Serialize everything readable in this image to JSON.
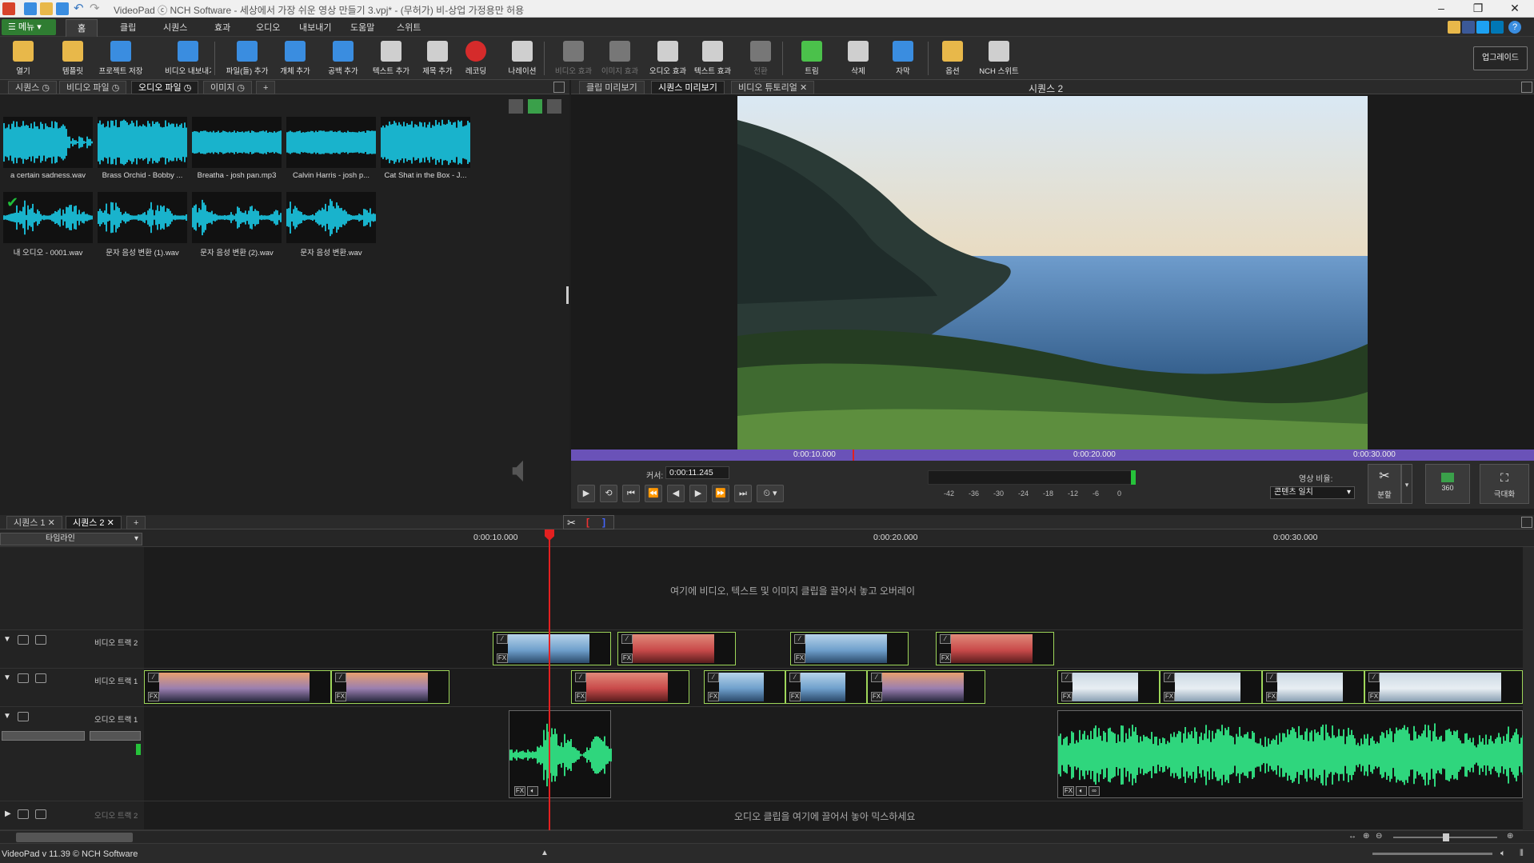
{
  "app": {
    "title": "VideoPad ⓒ NCH Software - 세상에서 가장 쉬운 영상 만들기 3.vpj* - (무허가) 비-상업 가정용만 허용",
    "status": "VideoPad v 11.39 © NCH Software"
  },
  "menubar": {
    "menu_button": "메뉴",
    "tabs": [
      "홈",
      "클립",
      "시퀀스",
      "효과",
      "오디오",
      "내보내기",
      "도움말",
      "스위트"
    ]
  },
  "toolbar": {
    "items": [
      {
        "label": "열기",
        "icon": "folder-open-icon",
        "color": "#e8b84a"
      },
      {
        "label": "템플릿",
        "icon": "template-icon",
        "color": "#e8b84a"
      },
      {
        "label": "프로젝트 저장",
        "icon": "save-icon",
        "color": "#3a8de0"
      },
      {
        "label": "비디오 내보내기",
        "icon": "export-video-icon",
        "color": "#3a8de0"
      },
      {
        "label": "파일(들) 추가",
        "icon": "add-files-icon",
        "color": "#3a8de0"
      },
      {
        "label": "개체 추가",
        "icon": "add-object-icon",
        "color": "#3a8de0"
      },
      {
        "label": "공백 추가",
        "icon": "add-blank-icon",
        "color": "#3a8de0"
      },
      {
        "label": "텍스트 추가",
        "icon": "add-text-icon",
        "color": "#cfcfcf"
      },
      {
        "label": "제목 추가",
        "icon": "add-title-icon",
        "color": "#cfcfcf"
      },
      {
        "label": "레코딩",
        "icon": "record-icon",
        "color": "#d52b2b"
      },
      {
        "label": "나레이션",
        "icon": "microphone-icon",
        "color": "#cfcfcf"
      },
      {
        "label": "비디오 효과",
        "icon": "video-effect-icon",
        "color": "#777777"
      },
      {
        "label": "이미지 효과",
        "icon": "image-effect-icon",
        "color": "#777777"
      },
      {
        "label": "오디오 효과",
        "icon": "audio-effect-icon",
        "color": "#cfcfcf"
      },
      {
        "label": "텍스트 효과",
        "icon": "text-effect-icon",
        "color": "#cfcfcf"
      },
      {
        "label": "전환",
        "icon": "transition-icon",
        "color": "#777777"
      },
      {
        "label": "트림",
        "icon": "trim-icon",
        "color": "#4bc14b"
      },
      {
        "label": "삭제",
        "icon": "trash-icon",
        "color": "#cfcfcf"
      },
      {
        "label": "자막",
        "icon": "subtitle-icon",
        "color": "#3a8de0"
      },
      {
        "label": "옵션",
        "icon": "options-icon",
        "color": "#e8b84a"
      },
      {
        "label": "NCH 스위트",
        "icon": "nch-suite-icon",
        "color": "#cfcfcf"
      }
    ],
    "upgrade": "업그레이드"
  },
  "bin": {
    "tabs": [
      "시퀀스",
      "비디오 파일",
      "오디오 파일",
      "이미지"
    ],
    "active_tab": 2,
    "add_tab": "+",
    "clips": [
      {
        "name": "a certain sadness.wav",
        "style": "cyan"
      },
      {
        "name": "Brass Orchid - Bobby ...",
        "style": "cyan"
      },
      {
        "name": "Breatha - josh pan.mp3",
        "style": "cyan"
      },
      {
        "name": "Calvin Harris - josh p...",
        "style": "cyan"
      },
      {
        "name": "Cat Shat in the Box - J...",
        "style": "cyan"
      },
      {
        "name": "내 오디오 - 0001.wav",
        "style": "wave"
      },
      {
        "name": "문자 음성 변환 (1).wav",
        "style": "wave"
      },
      {
        "name": "문자 음성 변환 (2).wav",
        "style": "wave"
      },
      {
        "name": "문자 음성 변환.wav",
        "style": "wave"
      }
    ]
  },
  "preview": {
    "tabs": [
      "클립 미리보기",
      "시퀀스 미리보기",
      "비디오 튜토리얼"
    ],
    "active_tab": 1,
    "sequence_title": "시퀀스 2",
    "scrub_ticks": [
      "0:00:10.000",
      "0:00:20.000",
      "0:00:30.000"
    ],
    "cursor_label": "커서:",
    "cursor_value": "0:00:11.245",
    "meter_labels": [
      "-42",
      "-36",
      "-30",
      "-24",
      "-18",
      "-12",
      "-6",
      "0"
    ],
    "aspect_label": "영상 비율:",
    "aspect_value": "콘텐츠 일치",
    "split_label": "분할",
    "vr_label": "360",
    "fullscreen_label": "극대화"
  },
  "timeline": {
    "seq_tabs": [
      "시퀀스 1",
      "시퀀스 2"
    ],
    "add_tab": "+",
    "dropdown": "타임라인",
    "ruler_ticks": [
      "0:00:10.000",
      "0:00:20.000",
      "0:00:30.000"
    ],
    "overlay_hint": "여기에 비디오, 텍스트 및 이미지 클립을 끌어서 놓고 오버레이",
    "tracks": {
      "video2": "비디오 트랙 2",
      "video1": "비디오 트랙 1",
      "audio1": "오디오 트랙 1",
      "audio2": "오디오 트랙 2"
    },
    "audio_hint": "오디오 클립을 여기에 끌어서 놓아 믹스하세요"
  }
}
